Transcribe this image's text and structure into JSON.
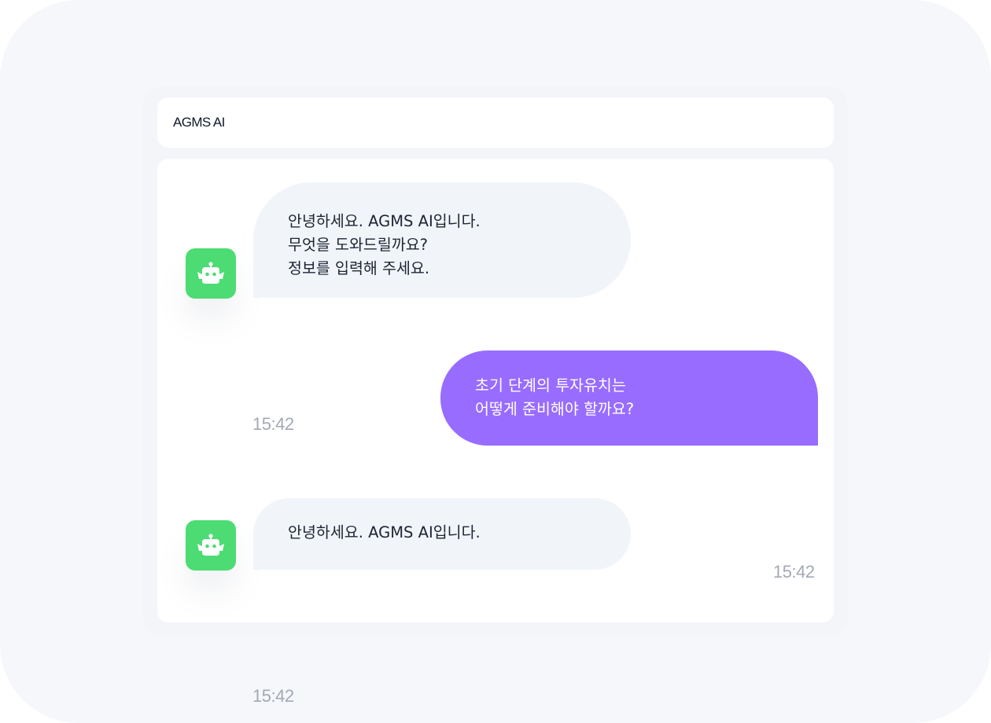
{
  "app": {
    "title": "AGMS AI"
  },
  "colors": {
    "accent": "#986cff",
    "bot_avatar": "#4cdc73",
    "bot_bubble": "#f1f5fa"
  },
  "messages": [
    {
      "sender": "bot",
      "icon": "robot-icon",
      "lines": [
        "안녕하세요. AGMS AI입니다.",
        "무엇을 도와드릴까요?",
        "정보를 입력해 주세요."
      ],
      "time": "15:42"
    },
    {
      "sender": "user",
      "lines": [
        "초기 단계의 투자유치는",
        "어떻게 준비해야 할까요?"
      ],
      "time": "15:42"
    },
    {
      "sender": "bot",
      "icon": "robot-icon",
      "lines": [
        "안녕하세요. AGMS AI입니다."
      ],
      "time": "15:42"
    }
  ]
}
